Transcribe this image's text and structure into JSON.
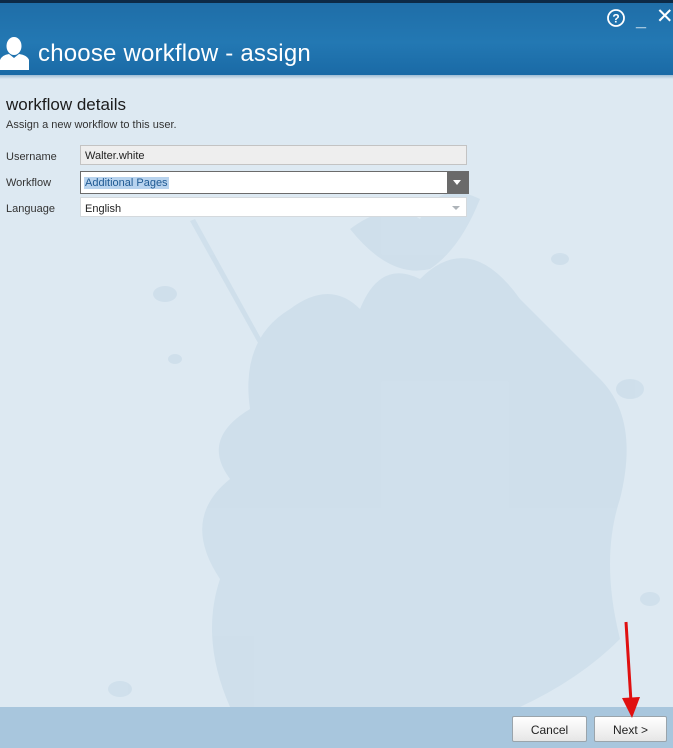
{
  "window": {
    "title": "choose workflow - assign",
    "controls": {
      "help": "?",
      "minimize": "_",
      "close": "✕"
    }
  },
  "section": {
    "title": "workflow details",
    "description": "Assign a new workflow to this user."
  },
  "form": {
    "username": {
      "label": "Username",
      "value": "Walter.white"
    },
    "workflow": {
      "label": "Workflow",
      "value": "Additional Pages"
    },
    "language": {
      "label": "Language",
      "value": "English"
    }
  },
  "buttons": {
    "cancel": "Cancel",
    "next": "Next >"
  },
  "colors": {
    "header": "#2378b3",
    "background": "#dde9f2",
    "footer": "#a8c6dd",
    "selection": "#b8d3ee",
    "annotation_arrow": "#e01010"
  },
  "icons": {
    "user": "user-silhouette-icon",
    "help": "help-circle-icon",
    "minimize": "minimize-icon",
    "close": "close-icon",
    "dropdown": "chevron-down-icon"
  }
}
